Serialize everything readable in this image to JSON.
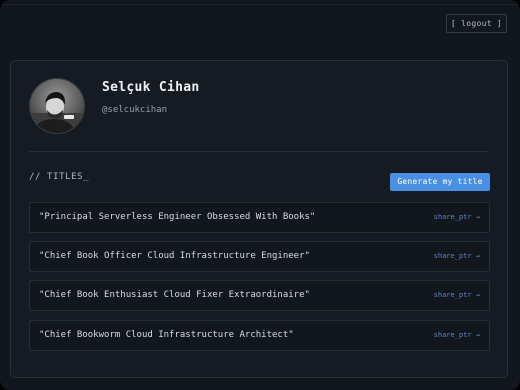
{
  "header": {
    "logout_label": "[ logout ]"
  },
  "profile": {
    "name": "Selçuk Cihan",
    "handle": "@selcukcihan"
  },
  "titles": {
    "section_label": "// TITLES_",
    "generate_label": "Generate my title",
    "items": [
      {
        "text": "\"Principal Serverless Engineer Obsessed With Books\"",
        "share_label": "share_ptr →"
      },
      {
        "text": "\"Chief Book Officer Cloud Infrastructure Engineer\"",
        "share_label": "share_ptr →"
      },
      {
        "text": "\"Chief Book Enthusiast Cloud Fixer Extraordinaire\"",
        "share_label": "share_ptr →"
      },
      {
        "text": "\"Chief Bookworm Cloud Infrastructure Architect\"",
        "share_label": "share_ptr →"
      }
    ]
  },
  "colors": {
    "background": "#12161d",
    "card": "#161b23",
    "accent": "#4a90e2",
    "link": "#5b86c9"
  }
}
